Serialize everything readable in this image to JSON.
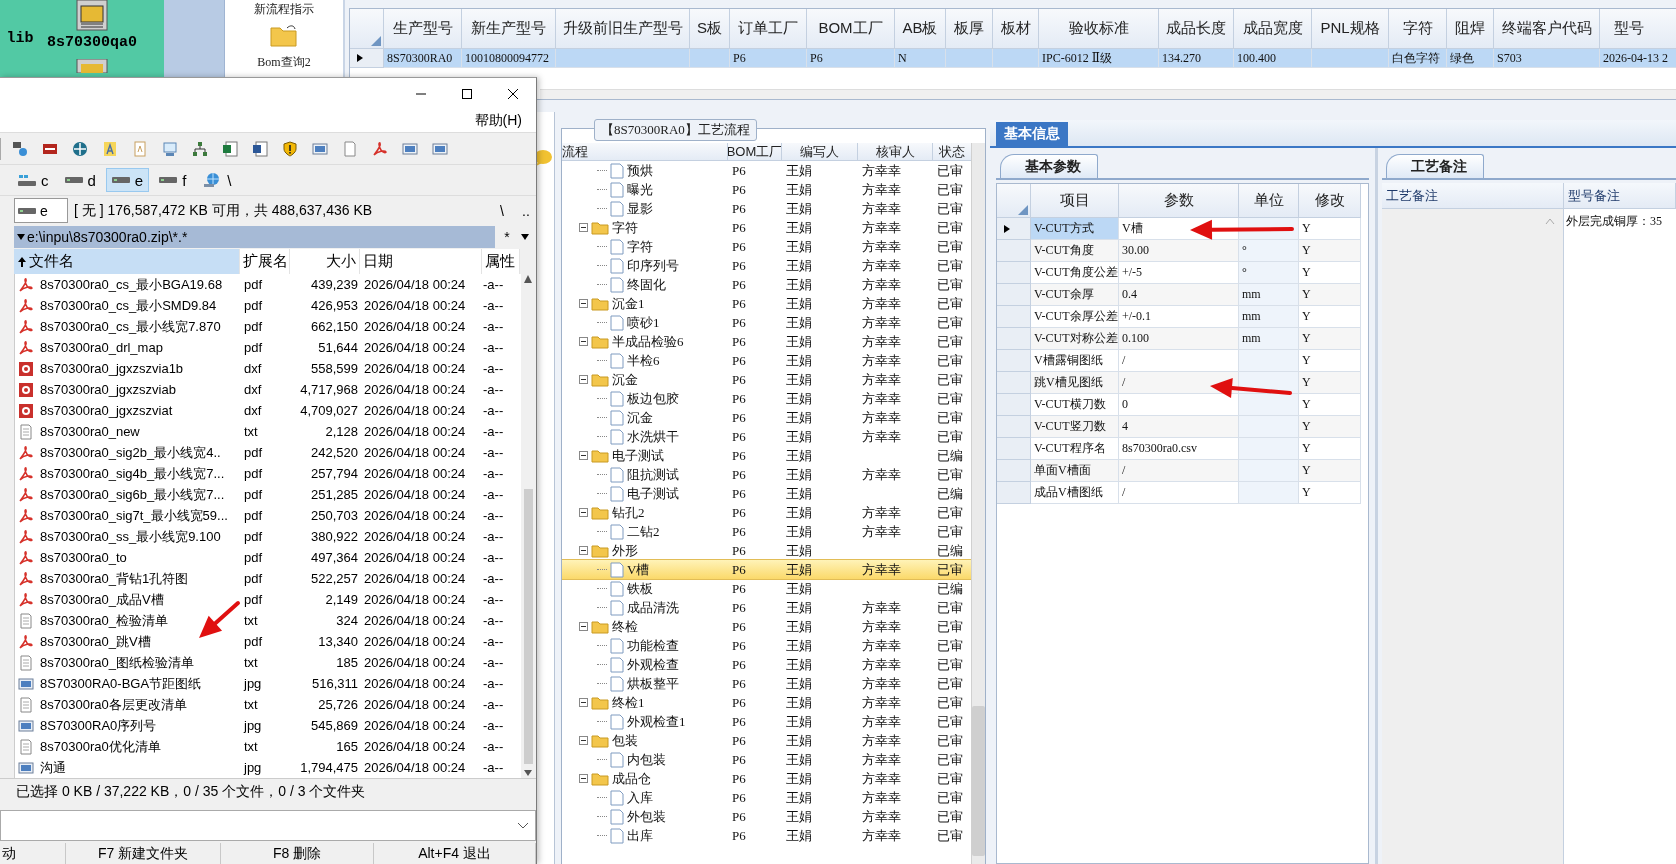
{
  "desktop": {
    "icons": [
      {
        "label": "lib"
      },
      {
        "label": "8s70300qa0"
      }
    ]
  },
  "erp": {
    "nav": {
      "items": [
        {
          "label": "新流程指示"
        },
        {
          "label": "Bom查询2"
        }
      ]
    },
    "main_info": {
      "columns": [
        "生产型号",
        "新生产型号",
        "升级前旧生产型号",
        "S板",
        "订单工厂",
        "BOM工厂",
        "AB板",
        "板厚",
        "板材",
        "验收标准",
        "成品长度",
        "成品宽度",
        "PNL规格",
        "字符",
        "阻焊",
        "终端客户代码",
        "型号"
      ],
      "rows": [
        {
          "selected": true,
          "cells": [
            "8S70300RA0",
            "10010800094772",
            null,
            null,
            "P6",
            "P6",
            "N",
            null,
            null,
            "IPC-6012 Ⅱ级",
            "134.270",
            "100.400",
            null,
            "白色字符",
            "绿色",
            "S703",
            "2026-04-13 2"
          ]
        }
      ]
    },
    "process": {
      "title": "【8S70300RA0】工艺流程",
      "columns": [
        "流程",
        "BOM工厂",
        "编写人",
        "核审人",
        "状态"
      ],
      "rows": [
        {
          "label": "预烘",
          "kind": "leaf",
          "bom": "P6",
          "writer": "王娟",
          "reviewer": "方幸幸",
          "status": "已审",
          "selected": false
        },
        {
          "label": "曝光",
          "kind": "leaf",
          "bom": "P6",
          "writer": "王娟",
          "reviewer": "方幸幸",
          "status": "已审",
          "selected": false
        },
        {
          "label": "显影",
          "kind": "leaf",
          "bom": "P6",
          "writer": "王娟",
          "reviewer": "方幸幸",
          "status": "已审",
          "selected": false
        },
        {
          "label": "字符",
          "kind": "folder",
          "expanded": true,
          "bom": "P6",
          "writer": "王娟",
          "reviewer": "方幸幸",
          "status": "已审",
          "selected": false,
          "children": [
            {
              "label": "字符",
              "kind": "leaf",
              "bom": "P6",
              "writer": "王娟",
              "reviewer": "方幸幸",
              "status": "已审",
              "selected": false
            },
            {
              "label": "印序列号",
              "kind": "leaf",
              "bom": "P6",
              "writer": "王娟",
              "reviewer": "方幸幸",
              "status": "已审",
              "selected": false
            },
            {
              "label": "终固化",
              "kind": "leaf",
              "bom": "P6",
              "writer": "王娟",
              "reviewer": "方幸幸",
              "status": "已审",
              "selected": false
            }
          ]
        },
        {
          "label": "沉金1",
          "kind": "folder",
          "expanded": true,
          "bom": "P6",
          "writer": "王娟",
          "reviewer": "方幸幸",
          "status": "已审",
          "selected": false,
          "children": [
            {
              "label": "喷砂1",
              "kind": "leaf",
              "bom": "P6",
              "writer": "王娟",
              "reviewer": "方幸幸",
              "status": "已审",
              "selected": false
            }
          ]
        },
        {
          "label": "半成品检验6",
          "kind": "folder",
          "expanded": true,
          "bom": "P6",
          "writer": "王娟",
          "reviewer": "方幸幸",
          "status": "已审",
          "selected": false,
          "children": [
            {
              "label": "半检6",
              "kind": "leaf",
              "bom": "P6",
              "writer": "王娟",
              "reviewer": "方幸幸",
              "status": "已审",
              "selected": false
            }
          ]
        },
        {
          "label": "沉金",
          "kind": "folder",
          "expanded": true,
          "bom": "P6",
          "writer": "王娟",
          "reviewer": "方幸幸",
          "status": "已审",
          "selected": false,
          "children": [
            {
              "label": "板边包胶",
              "kind": "leaf",
              "bom": "P6",
              "writer": "王娟",
              "reviewer": "方幸幸",
              "status": "已审",
              "selected": false
            },
            {
              "label": "沉金",
              "kind": "leaf",
              "bom": "P6",
              "writer": "王娟",
              "reviewer": "方幸幸",
              "status": "已审",
              "selected": false
            },
            {
              "label": "水洗烘干",
              "kind": "leaf",
              "bom": "P6",
              "writer": "王娟",
              "reviewer": "方幸幸",
              "status": "已审",
              "selected": false
            }
          ]
        },
        {
          "label": "电子测试",
          "kind": "folder",
          "expanded": true,
          "bom": "P6",
          "writer": "王娟",
          "status": "已编",
          "selected": false,
          "children": [
            {
              "label": "阻抗测试",
              "kind": "leaf",
              "bom": "P6",
              "writer": "王娟",
              "reviewer": "方幸幸",
              "status": "已审",
              "selected": false
            },
            {
              "label": "电子测试",
              "kind": "leaf",
              "bom": "P6",
              "writer": "王娟",
              "status": "已编",
              "selected": false
            }
          ]
        },
        {
          "label": "钻孔2",
          "kind": "folder",
          "expanded": true,
          "bom": "P6",
          "writer": "王娟",
          "reviewer": "方幸幸",
          "status": "已审",
          "selected": false,
          "children": [
            {
              "label": "二钻2",
              "kind": "leaf",
              "bom": "P6",
              "writer": "王娟",
              "reviewer": "方幸幸",
              "status": "已审",
              "selected": false
            }
          ]
        },
        {
          "label": "外形",
          "kind": "folder",
          "expanded": true,
          "bom": "P6",
          "writer": "王娟",
          "status": "已编",
          "selected": false,
          "children": [
            {
              "label": "V槽",
              "kind": "leaf",
              "bom": "P6",
              "writer": "王娟",
              "reviewer": "方幸幸",
              "status": "已审",
              "selected": true
            },
            {
              "label": "铁板",
              "kind": "leaf",
              "bom": "P6",
              "writer": "王娟",
              "status": "已编",
              "selected": false
            },
            {
              "label": "成品清洗",
              "kind": "leaf",
              "bom": "P6",
              "writer": "王娟",
              "reviewer": "方幸幸",
              "status": "已审",
              "selected": false
            }
          ]
        },
        {
          "label": "终检",
          "kind": "folder",
          "expanded": true,
          "bom": "P6",
          "writer": "王娟",
          "reviewer": "方幸幸",
          "status": "已审",
          "selected": false,
          "children": [
            {
              "label": "功能检查",
              "kind": "leaf",
              "bom": "P6",
              "writer": "王娟",
              "reviewer": "方幸幸",
              "status": "已审",
              "selected": false
            },
            {
              "label": "外观检查",
              "kind": "leaf",
              "bom": "P6",
              "writer": "王娟",
              "reviewer": "方幸幸",
              "status": "已审",
              "selected": false
            },
            {
              "label": "烘板整平",
              "kind": "leaf",
              "bom": "P6",
              "writer": "王娟",
              "reviewer": "方幸幸",
              "status": "已审",
              "selected": false
            }
          ]
        },
        {
          "label": "终检1",
          "kind": "folder",
          "expanded": true,
          "bom": "P6",
          "writer": "王娟",
          "reviewer": "方幸幸",
          "status": "已审",
          "selected": false,
          "children": [
            {
              "label": "外观检查1",
              "kind": "leaf",
              "bom": "P6",
              "writer": "王娟",
              "reviewer": "方幸幸",
              "status": "已审",
              "selected": false
            }
          ]
        },
        {
          "label": "包装",
          "kind": "folder",
          "expanded": true,
          "bom": "P6",
          "writer": "王娟",
          "reviewer": "方幸幸",
          "status": "已审",
          "selected": false,
          "children": [
            {
              "label": "内包装",
              "kind": "leaf",
              "bom": "P6",
              "writer": "王娟",
              "reviewer": "方幸幸",
              "status": "已审",
              "selected": false
            }
          ]
        },
        {
          "label": "成品仓",
          "kind": "folder",
          "expanded": true,
          "bom": "P6",
          "writer": "王娟",
          "reviewer": "方幸幸",
          "status": "已审",
          "selected": false,
          "children": [
            {
              "label": "入库",
              "kind": "leaf",
              "bom": "P6",
              "writer": "王娟",
              "reviewer": "方幸幸",
              "status": "已审",
              "selected": false
            },
            {
              "label": "外包装",
              "kind": "leaf",
              "bom": "P6",
              "writer": "王娟",
              "reviewer": "方幸幸",
              "status": "已审",
              "selected": false
            },
            {
              "label": "出库",
              "kind": "leaf",
              "bom": "P6",
              "writer": "王娟",
              "reviewer": "方幸幸",
              "status": "已审",
              "selected": false
            }
          ]
        }
      ]
    },
    "info": {
      "tab": "基本信息",
      "params": {
        "tab": "基本参数",
        "columns": [
          "项目",
          "参数",
          "单位",
          "修改"
        ],
        "rows": [
          {
            "selected": true,
            "cells": [
              "V-CUT方式",
              "V槽",
              null,
              "Y"
            ]
          },
          {
            "selected": false,
            "cells": [
              "V-CUT角度",
              "30.00",
              "°",
              "Y"
            ]
          },
          {
            "selected": false,
            "cells": [
              "V-CUT角度公差",
              "+/-5",
              "°",
              "Y"
            ]
          },
          {
            "selected": false,
            "cells": [
              "V-CUT余厚",
              "0.4",
              "mm",
              "Y"
            ]
          },
          {
            "selected": false,
            "cells": [
              "V-CUT余厚公差",
              "+/-0.1",
              "mm",
              "Y"
            ]
          },
          {
            "selected": false,
            "cells": [
              "V-CUT对称公差",
              "0.100",
              "mm",
              "Y"
            ]
          },
          {
            "selected": false,
            "cells": [
              "V槽露铜图纸",
              "/",
              null,
              "Y"
            ]
          },
          {
            "selected": false,
            "cells": [
              "跳V槽见图纸",
              "/",
              null,
              "Y"
            ]
          },
          {
            "selected": false,
            "cells": [
              "V-CUT横刀数",
              "0",
              null,
              "Y"
            ]
          },
          {
            "selected": false,
            "cells": [
              "V-CUT竖刀数",
              "4",
              null,
              "Y"
            ]
          },
          {
            "selected": false,
            "cells": [
              "V-CUT程序名",
              "8s70300ra0.csv",
              null,
              "Y"
            ]
          },
          {
            "selected": false,
            "cells": [
              "单面V槽面",
              "/",
              null,
              "Y"
            ]
          },
          {
            "selected": false,
            "cells": [
              "成品V槽图纸",
              "/",
              null,
              "Y"
            ]
          }
        ]
      },
      "notes": {
        "tab": "工艺备注",
        "columns": [
          "工艺备注",
          "型号备注"
        ],
        "text": "外层完成铜厚：35"
      }
    }
  },
  "file_manager": {
    "menu": [
      "帮助(H)"
    ],
    "drives": [
      {
        "label": "c",
        "kind": "network",
        "selected": false
      },
      {
        "label": "d",
        "kind": "drive",
        "selected": false
      },
      {
        "label": "e",
        "kind": "drive",
        "selected": true
      },
      {
        "label": "f",
        "kind": "drive",
        "selected": false
      },
      {
        "label": "\\",
        "kind": "globe",
        "selected": false
      }
    ],
    "drive_select": "e",
    "free_space": "[ 无 ]  176,587,472 KB 可用，共 488,637,436 KB",
    "nav_buttons": [
      "\\",
      ".."
    ],
    "path": "e:\\inpu\\8s70300ra0.zip\\*.*",
    "filter": "*",
    "columns": [
      "文件名",
      "扩展名",
      "大小",
      "日期",
      "属性"
    ],
    "files": [
      {
        "name": "8s70300ra0_cs_最小BGA19.68",
        "ext": "pdf",
        "size": "439,239",
        "date": "2026/04/18 00:24",
        "attr": "-a--",
        "kind": "pdf"
      },
      {
        "name": "8s70300ra0_cs_最小SMD9.84",
        "ext": "pdf",
        "size": "426,953",
        "date": "2026/04/18 00:24",
        "attr": "-a--",
        "kind": "pdf"
      },
      {
        "name": "8s70300ra0_cs_最小线宽7.870",
        "ext": "pdf",
        "size": "662,150",
        "date": "2026/04/18 00:24",
        "attr": "-a--",
        "kind": "pdf"
      },
      {
        "name": "8s70300ra0_drl_map",
        "ext": "pdf",
        "size": "51,644",
        "date": "2026/04/18 00:24",
        "attr": "-a--",
        "kind": "pdf"
      },
      {
        "name": "8s70300ra0_jgxzszvia1b",
        "ext": "dxf",
        "size": "558,599",
        "date": "2026/04/18 00:24",
        "attr": "-a--",
        "kind": "dxf"
      },
      {
        "name": "8s70300ra0_jgxzszviab",
        "ext": "dxf",
        "size": "4,717,968",
        "date": "2026/04/18 00:24",
        "attr": "-a--",
        "kind": "dxf"
      },
      {
        "name": "8s70300ra0_jgxzszviat",
        "ext": "dxf",
        "size": "4,709,027",
        "date": "2026/04/18 00:24",
        "attr": "-a--",
        "kind": "dxf"
      },
      {
        "name": "8s70300ra0_new",
        "ext": "txt",
        "size": "2,128",
        "date": "2026/04/18 00:24",
        "attr": "-a--",
        "kind": "txt"
      },
      {
        "name": "8s70300ra0_sig2b_最小线宽4..",
        "ext": "pdf",
        "size": "242,520",
        "date": "2026/04/18 00:24",
        "attr": "-a--",
        "kind": "pdf"
      },
      {
        "name": "8s70300ra0_sig4b_最小线宽7...",
        "ext": "pdf",
        "size": "257,794",
        "date": "2026/04/18 00:24",
        "attr": "-a--",
        "kind": "pdf"
      },
      {
        "name": "8s70300ra0_sig6b_最小线宽7...",
        "ext": "pdf",
        "size": "251,285",
        "date": "2026/04/18 00:24",
        "attr": "-a--",
        "kind": "pdf"
      },
      {
        "name": "8s70300ra0_sig7t_最小线宽59...",
        "ext": "pdf",
        "size": "250,703",
        "date": "2026/04/18 00:24",
        "attr": "-a--",
        "kind": "pdf"
      },
      {
        "name": "8s70300ra0_ss_最小线宽9.100",
        "ext": "pdf",
        "size": "380,922",
        "date": "2026/04/18 00:24",
        "attr": "-a--",
        "kind": "pdf"
      },
      {
        "name": "8s70300ra0_to",
        "ext": "pdf",
        "size": "497,364",
        "date": "2026/04/18 00:24",
        "attr": "-a--",
        "kind": "pdf"
      },
      {
        "name": "8s70300ra0_背钻1孔符图",
        "ext": "pdf",
        "size": "522,257",
        "date": "2026/04/18 00:24",
        "attr": "-a--",
        "kind": "pdf"
      },
      {
        "name": "8s70300ra0_成品V槽",
        "ext": "pdf",
        "size": "2,149",
        "date": "2026/04/18 00:24",
        "attr": "-a--",
        "kind": "pdf"
      },
      {
        "name": "8s70300ra0_检验清单",
        "ext": "txt",
        "size": "324",
        "date": "2026/04/18 00:24",
        "attr": "-a--",
        "kind": "txt"
      },
      {
        "name": "8s70300ra0_跳V槽",
        "ext": "pdf",
        "size": "13,340",
        "date": "2026/04/18 00:24",
        "attr": "-a--",
        "kind": "pdf"
      },
      {
        "name": "8s70300ra0_图纸检验清单",
        "ext": "txt",
        "size": "185",
        "date": "2026/04/18 00:24",
        "attr": "-a--",
        "kind": "txt"
      },
      {
        "name": "8S70300RA0-BGA节距图纸",
        "ext": "jpg",
        "size": "516,311",
        "date": "2026/04/18 00:24",
        "attr": "-a--",
        "kind": "jpg"
      },
      {
        "name": "8s70300ra0各层更改清单",
        "ext": "txt",
        "size": "25,726",
        "date": "2026/04/18 00:24",
        "attr": "-a--",
        "kind": "txt"
      },
      {
        "name": "8S70300RA0序列号",
        "ext": "jpg",
        "size": "545,869",
        "date": "2026/04/18 00:24",
        "attr": "-a--",
        "kind": "jpg"
      },
      {
        "name": "8s70300ra0优化清单",
        "ext": "txt",
        "size": "165",
        "date": "2026/04/18 00:24",
        "attr": "-a--",
        "kind": "txt"
      },
      {
        "name": "沟通",
        "ext": "jpg",
        "size": "1,794,475",
        "date": "2026/04/18 00:24",
        "attr": "-a--",
        "kind": "jpg"
      }
    ],
    "status": "已选择 0 KB / 37,222 KB，0 / 35 个文件，0 / 3 个文件夹",
    "buttons": [
      "动",
      "F7 新建文件夹",
      "F8 删除",
      "Alt+F4 退出"
    ]
  }
}
